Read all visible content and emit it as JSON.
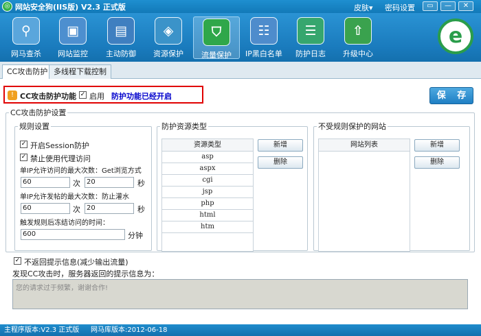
{
  "app": {
    "title": "网站安全狗(IIS版) V2.3 正式版",
    "logo_glyph": "◎",
    "skin_menu": "皮肤▾",
    "password_menu": "密码设置",
    "window_buttons": {
      "menu": "▭",
      "minimize": "—",
      "close": "✕"
    }
  },
  "toolbar": {
    "items": [
      {
        "id": "trojan-scan",
        "label": "网马查杀",
        "icon": "trojan-scan-icon",
        "glyph": "⚲",
        "color": "#5aa6dc"
      },
      {
        "id": "site-monitor",
        "label": "网站监控",
        "icon": "monitor-icon",
        "glyph": "▣",
        "color": "#4d8fcf"
      },
      {
        "id": "active-defense",
        "label": "主动防御",
        "icon": "active-defense-icon",
        "glyph": "▤",
        "color": "#3f7fc0"
      },
      {
        "id": "resource-protect",
        "label": "资源保护",
        "icon": "resource-protect-icon",
        "glyph": "◈",
        "color": "#3b93c9"
      },
      {
        "id": "traffic-protect",
        "label": "流量保护",
        "icon": "traffic-protect-icon",
        "glyph": "⛉",
        "color": "#2fa74a",
        "active": true
      },
      {
        "id": "ip-list",
        "label": "IP黑白名单",
        "icon": "ip-list-icon",
        "glyph": "☷",
        "color": "#4e8ccc"
      },
      {
        "id": "protect-log",
        "label": "防护日志",
        "icon": "log-icon",
        "glyph": "☰",
        "color": "#36a66e"
      },
      {
        "id": "upgrade",
        "label": "升级中心",
        "icon": "upgrade-icon",
        "glyph": "⇧",
        "color": "#3aa24e"
      }
    ],
    "brand_glyph": "e"
  },
  "tabs": [
    {
      "label": "CC攻击防护",
      "active": true
    },
    {
      "label": "多线程下载控制",
      "active": false
    }
  ],
  "cc": {
    "enable_title": "CC攻击防护功能",
    "enable_checked": "✓",
    "enable_label": "启用",
    "status": "防护功能已经开启",
    "save_label": "保 存",
    "settings_legend": "CC攻击防护设置",
    "rules": {
      "legend": "规则设置",
      "session_checked": "✓",
      "session_label": "开启Session防护",
      "proxy_checked": "✓",
      "proxy_label": "禁止使用代理访问",
      "visit_limit_label": "单IP允许访问的最大次数：Get浏览方式",
      "visit_count": "60",
      "times_unit_1": "次",
      "visit_seconds": "20",
      "seconds_unit_1": "秒",
      "post_limit_label": "单IP允许发帖的最大次数：防止灌水",
      "post_count": "60",
      "times_unit_2": "次",
      "post_seconds": "20",
      "seconds_unit_2": "秒",
      "freeze_label": "触发规则后冻结访问的时间：",
      "freeze_value": "600",
      "freeze_unit": "分钟"
    },
    "resources": {
      "legend": "防护资源类型",
      "header": "资源类型",
      "items": [
        "asp",
        "aspx",
        "cgi",
        "jsp",
        "php",
        "html",
        "htm"
      ],
      "add_label": "新增",
      "delete_label": "删除"
    },
    "exempt_sites": {
      "legend": "不受规则保护的网站",
      "header": "网站列表",
      "add_label": "新增",
      "delete_label": "删除"
    },
    "no_return_checked": "✓",
    "no_return_label": "不返回提示信息(减少输出流量)",
    "return_msg_label": "发现CC攻击时，服务器返回的提示信息为：",
    "return_msg": "您的请求过于频繁，谢谢合作!"
  },
  "statusbar": {
    "main_version": "主程序版本:V2.3 正式版",
    "db_version": "网马库版本:2012-06-18"
  }
}
